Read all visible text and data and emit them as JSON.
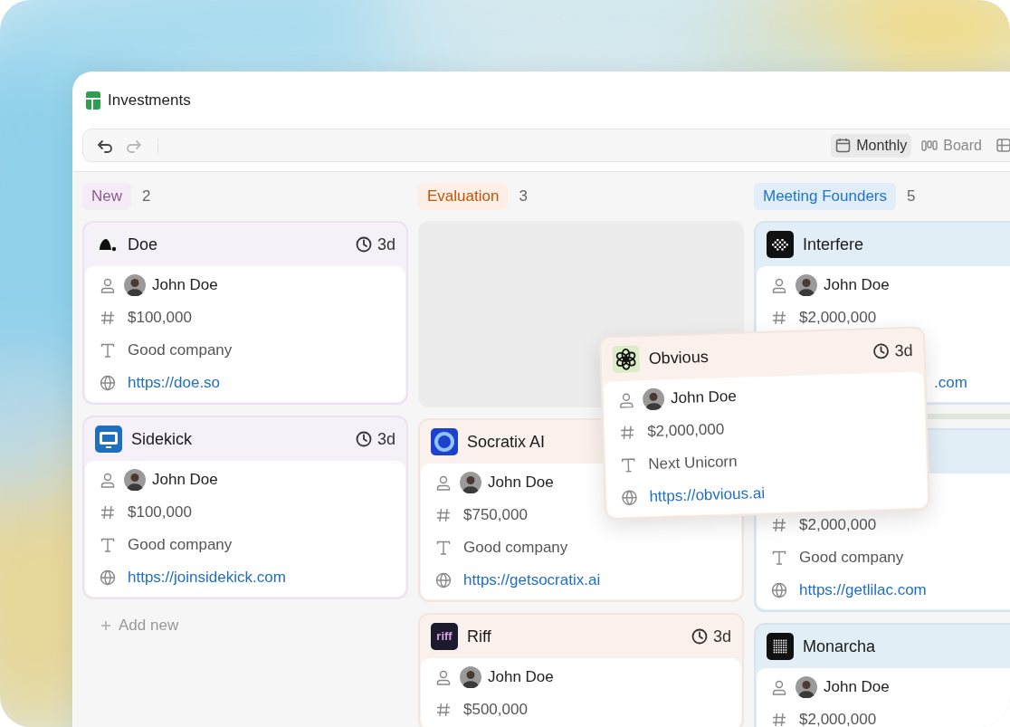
{
  "window": {
    "title": "Investments"
  },
  "toolbar": {
    "undo": {
      "disabled": false
    },
    "redo": {
      "disabled": true
    },
    "views": [
      {
        "label": "Monthly",
        "kind": "calendar",
        "selected": true
      },
      {
        "label": "Board",
        "kind": "board",
        "selected": false
      },
      {
        "kind": "table",
        "selected": false
      }
    ]
  },
  "columns": [
    {
      "title": "New",
      "count": "2",
      "color": "#8a5a8e",
      "cards": [
        {
          "name": "Doe",
          "logo": {
            "kind": "blob"
          },
          "age": "3d",
          "fields": [
            {
              "kind": "person",
              "value": "John Doe"
            },
            {
              "kind": "amount",
              "value": "$100,000"
            },
            {
              "kind": "text",
              "value": "Good company"
            },
            {
              "kind": "link",
              "value": "https://doe.so"
            }
          ]
        },
        {
          "name": "Sidekick",
          "logo": {
            "kind": "monitor"
          },
          "age": "3d",
          "fields": [
            {
              "kind": "person",
              "value": "John Doe"
            },
            {
              "kind": "amount",
              "value": "$100,000"
            },
            {
              "kind": "text",
              "value": "Good company"
            },
            {
              "kind": "link",
              "value": "https://joinsidekick.com"
            }
          ]
        }
      ],
      "add_new": "Add new"
    },
    {
      "title": "Evaluation",
      "count": "3",
      "color": "#c2540a",
      "placeholder_slot": true,
      "cards": [
        {
          "name": "Socratix AI",
          "logo": {
            "kind": "ring"
          },
          "fields": [
            {
              "kind": "person",
              "value": "John Doe"
            },
            {
              "kind": "amount",
              "value": "$750,000"
            },
            {
              "kind": "text",
              "value": "Good company"
            },
            {
              "kind": "link",
              "value": "https://getsocratix.ai"
            }
          ]
        },
        {
          "name": "Riff",
          "logo": {
            "kind": "text",
            "text": "riff"
          },
          "age": "3d",
          "fields": [
            {
              "kind": "person",
              "value": "John Doe"
            },
            {
              "kind": "amount",
              "value": "$500,000"
            }
          ]
        }
      ]
    },
    {
      "title": "Meeting Founders",
      "count": "5",
      "color": "#1f74c9",
      "cards": [
        {
          "name": "Interfere",
          "logo": {
            "kind": "checker"
          },
          "fields": [
            {
              "kind": "person",
              "value": "John Doe"
            },
            {
              "kind": "amount",
              "value": "$2,000,000"
            },
            {
              "kind": "covered"
            },
            {
              "kind": "link_tail",
              "value": ".com"
            }
          ]
        },
        {
          "drop_indicator": true,
          "fields": [
            {
              "kind": "covered"
            },
            {
              "kind": "amount",
              "value": "$2,000,000"
            },
            {
              "kind": "text",
              "value": "Good company"
            },
            {
              "kind": "link",
              "value": "https://getlilac.com"
            }
          ]
        },
        {
          "name": "Monarcha",
          "logo": {
            "kind": "dots"
          },
          "fields": [
            {
              "kind": "person",
              "value": "John Doe"
            },
            {
              "kind": "amount",
              "value": "$2,000,000"
            }
          ]
        }
      ]
    }
  ],
  "dragged_card": {
    "name": "Obvious",
    "logo": {
      "kind": "flower"
    },
    "age": "3d",
    "fields": [
      {
        "kind": "person",
        "value": "John Doe"
      },
      {
        "kind": "amount",
        "value": "$2,000,000"
      },
      {
        "kind": "text",
        "value": "Next Unicorn"
      },
      {
        "kind": "link",
        "value": "https://obvious.ai"
      }
    ]
  }
}
